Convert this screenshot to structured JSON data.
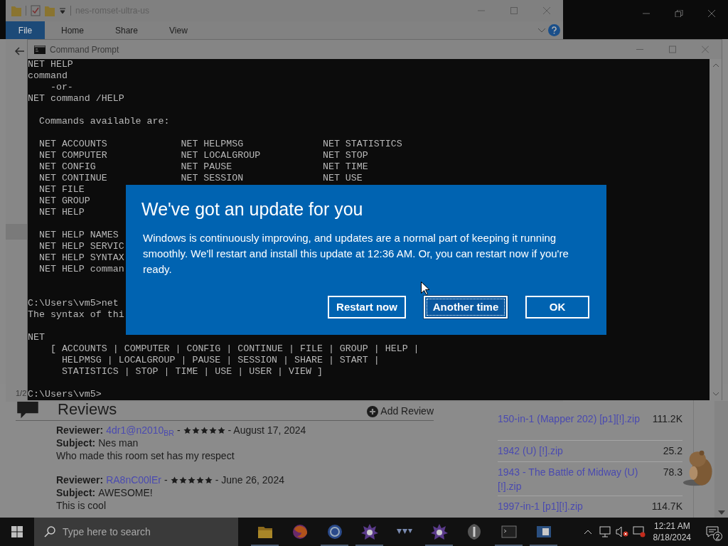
{
  "explorer": {
    "title": "nes-romset-ultra-us",
    "ribbon_tabs": [
      {
        "label": "File",
        "selected": true
      },
      {
        "label": "Home",
        "selected": false
      },
      {
        "label": "Share",
        "selected": false
      },
      {
        "label": "View",
        "selected": false
      }
    ],
    "status": "1/2"
  },
  "command_prompt": {
    "title": "Command Prompt",
    "lines": [
      {
        "kind": "text",
        "text": "NET HELP"
      },
      {
        "kind": "text",
        "text": "command"
      },
      {
        "kind": "text",
        "text": "    -or-"
      },
      {
        "kind": "text",
        "text": "NET command /HELP"
      },
      {
        "kind": "blank"
      },
      {
        "kind": "text",
        "text": "  Commands available are:"
      },
      {
        "kind": "blank"
      },
      {
        "kind": "text",
        "text": "  NET ACCOUNTS             NET HELPMSG              NET STATISTICS"
      },
      {
        "kind": "text",
        "text": "  NET COMPUTER             NET LOCALGROUP           NET STOP"
      },
      {
        "kind": "text",
        "text": "  NET CONFIG               NET PAUSE                NET TIME"
      },
      {
        "kind": "text",
        "text": "  NET CONTINUE             NET SESSION              NET USE"
      },
      {
        "kind": "text",
        "text": "  NET FILE"
      },
      {
        "kind": "text",
        "text": "  NET GROUP"
      },
      {
        "kind": "text",
        "text": "  NET HELP"
      },
      {
        "kind": "blank"
      },
      {
        "kind": "text",
        "text": "  NET HELP NAMES"
      },
      {
        "kind": "text",
        "text": "  NET HELP SERVIC"
      },
      {
        "kind": "text",
        "text": "  NET HELP SYNTAX"
      },
      {
        "kind": "text",
        "text": "  NET HELP comman"
      },
      {
        "kind": "blank"
      },
      {
        "kind": "blank"
      },
      {
        "kind": "text",
        "text": "C:\\Users\\vm5>net"
      },
      {
        "kind": "text",
        "text": "The syntax of thi"
      },
      {
        "kind": "blank"
      },
      {
        "kind": "text",
        "text": "NET"
      },
      {
        "kind": "text",
        "text": "    [ ACCOUNTS | COMPUTER | CONFIG | CONTINUE | FILE | GROUP | HELP |"
      },
      {
        "kind": "text",
        "text": "      HELPMSG | LOCALGROUP | PAUSE | SESSION | SHARE | START |"
      },
      {
        "kind": "text",
        "text": "      STATISTICS | STOP | TIME | USE | USER | VIEW ]"
      },
      {
        "kind": "blank"
      },
      {
        "kind": "text",
        "text": "C:\\Users\\vm5>"
      }
    ]
  },
  "dialog": {
    "title": "We've got an update for you",
    "message": "Windows is continuously improving, and updates are a normal part of keeping it running smoothly. We'll restart and install this update at 12:36 AM. Or, you can restart now if you're ready.",
    "buttons": [
      {
        "label": "Restart now",
        "focused": false
      },
      {
        "label": "Another time",
        "focused": true
      },
      {
        "label": "OK",
        "focused": false
      }
    ]
  },
  "web_page": {
    "reviews_heading": "Reviews",
    "add_review": "Add Review",
    "reviews": [
      {
        "reviewer_label": "Reviewer:",
        "reviewer": "4dr1@n2010$_{BR}$",
        "separator": "-",
        "stars": 5,
        "date": "- August 17, 2024",
        "subject_label": "Subject:",
        "subject": "Nes man",
        "body": "Who made this room set has my respect"
      },
      {
        "reviewer_label": "Reviewer:",
        "reviewer": "RA8nC00lEr",
        "separator": "-",
        "stars": 5,
        "date": "- June 26, 2024",
        "subject_label": "Subject:",
        "subject": "AWESOME!",
        "body": "This is cool"
      }
    ],
    "files": [
      {
        "name": "150-in-1 (Mapper 202) [p1][!].zip",
        "size": "111.2K"
      },
      {
        "name": "1942 (U) [!].zip",
        "size": "25.2"
      },
      {
        "name": "1943 - The Battle of Midway (U) [!].zip",
        "size": "78.3"
      },
      {
        "name": "1997-in-1 [p1][!].zip",
        "size": "114.7K"
      }
    ]
  },
  "taskbar": {
    "search_placeholder": "Type here to search",
    "time": "12:21 AM",
    "date": "8/18/2024",
    "notification_count": "2"
  }
}
